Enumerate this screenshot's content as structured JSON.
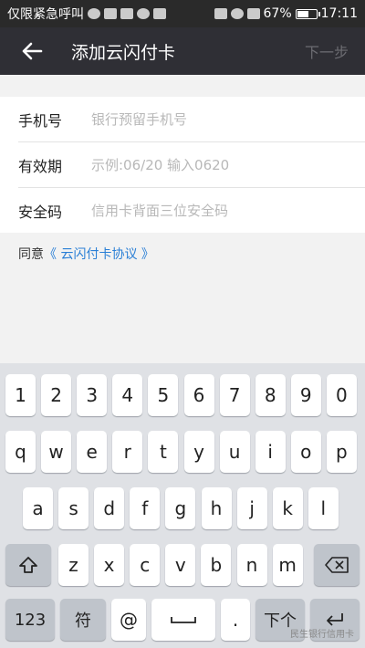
{
  "status": {
    "carrier": "仅限紧急呼叫",
    "battery": "67%",
    "battery_level": 0.67,
    "time": "17:11"
  },
  "header": {
    "title": "添加云闪付卡",
    "next_label": "下一步"
  },
  "form": {
    "fields": [
      {
        "label": "手机号",
        "placeholder": "银行预留手机号",
        "value": ""
      },
      {
        "label": "有效期",
        "placeholder": "示例:06/20 输入0620",
        "value": ""
      },
      {
        "label": "安全码",
        "placeholder": "信用卡背面三位安全码",
        "value": ""
      }
    ]
  },
  "agreement": {
    "prefix": "同意",
    "link": "《 云闪付卡协议 》"
  },
  "keyboard": {
    "row1": [
      "1",
      "2",
      "3",
      "4",
      "5",
      "6",
      "7",
      "8",
      "9",
      "0"
    ],
    "row2": [
      "q",
      "w",
      "e",
      "r",
      "t",
      "y",
      "u",
      "i",
      "o",
      "p"
    ],
    "row3": [
      "a",
      "s",
      "d",
      "f",
      "g",
      "h",
      "j",
      "k",
      "l"
    ],
    "row4": [
      "z",
      "x",
      "c",
      "v",
      "b",
      "n",
      "m"
    ],
    "key_123": "123",
    "key_symbol": "符",
    "key_at": "@",
    "key_dot": ".",
    "key_next": "下个"
  },
  "watermark": "民生银行信用卡"
}
